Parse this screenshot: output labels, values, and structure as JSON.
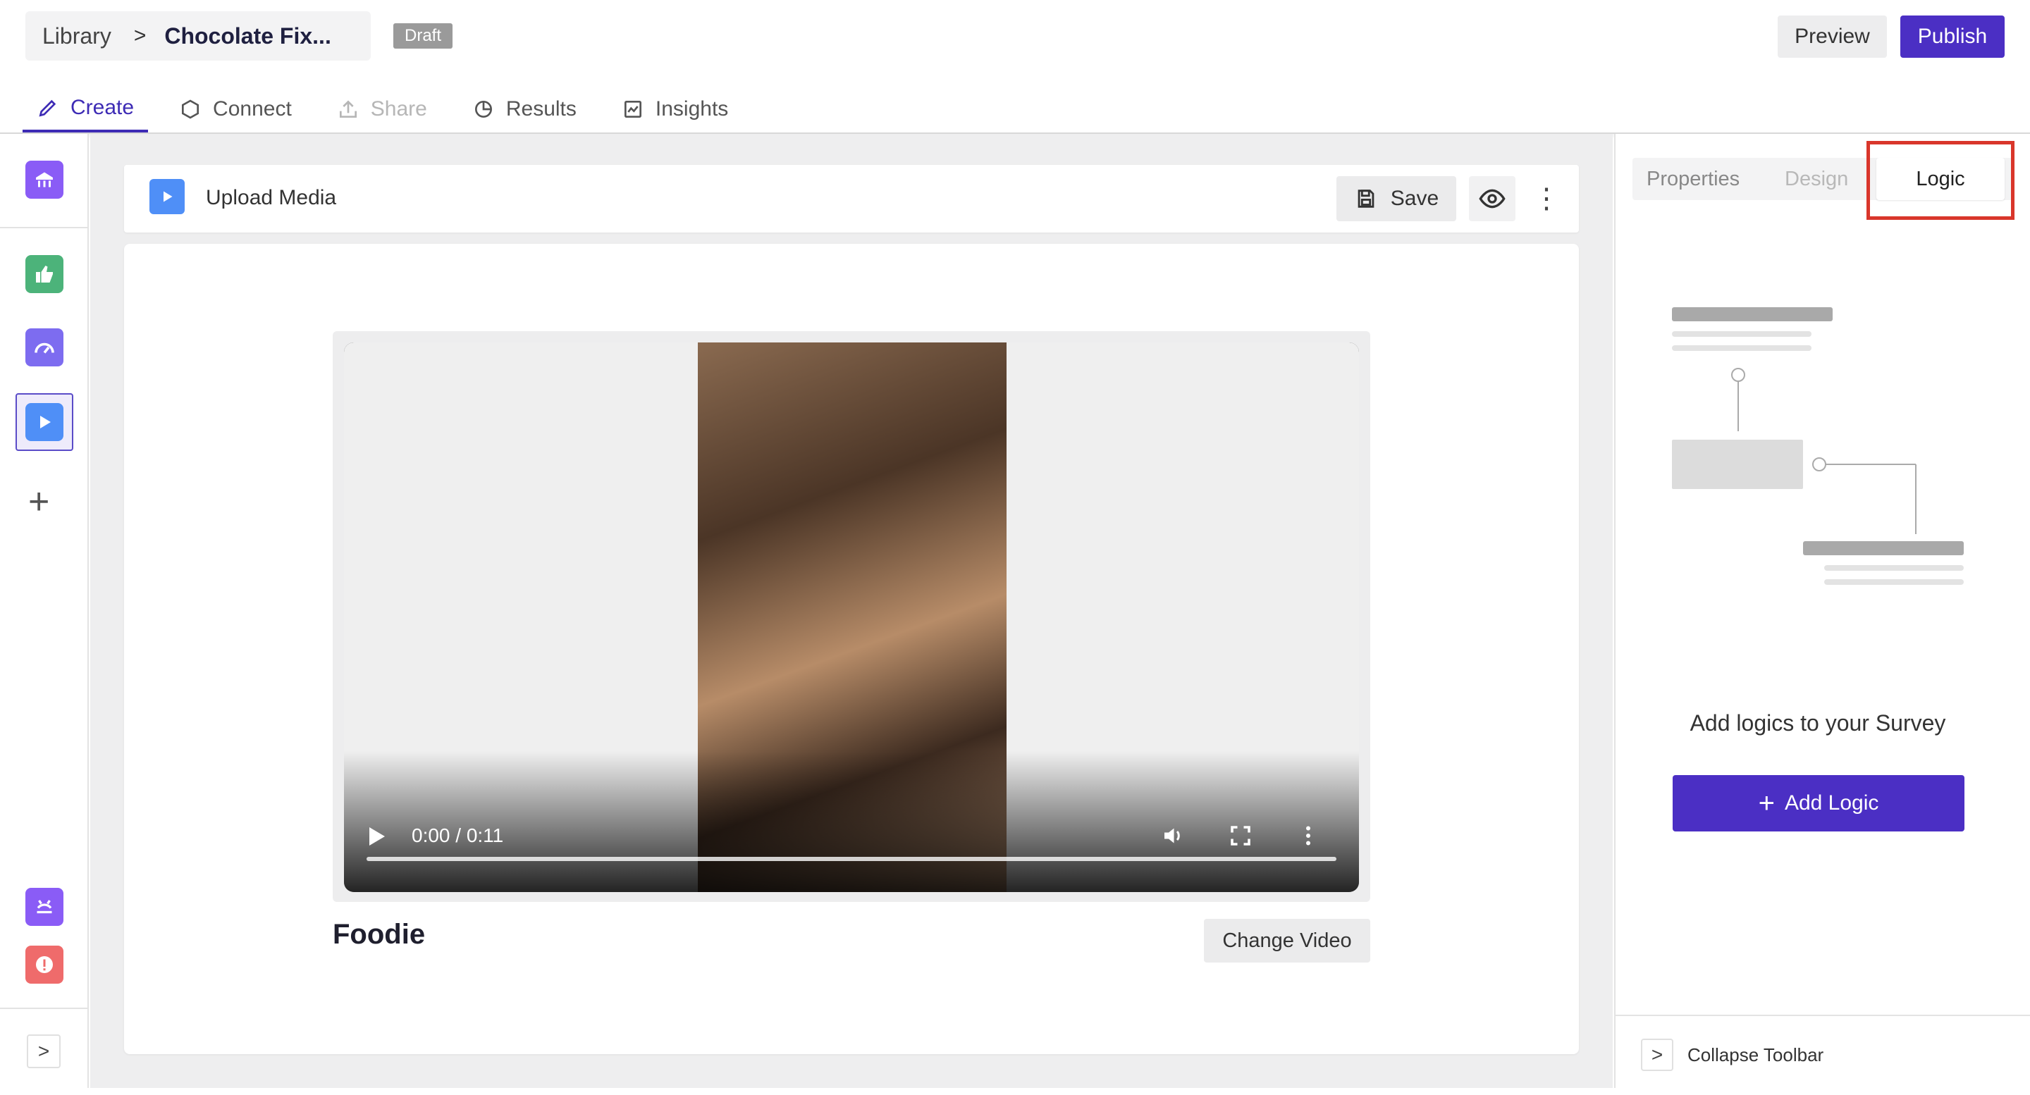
{
  "header": {
    "breadcrumb_root": "Library",
    "breadcrumb_separator": ">",
    "breadcrumb_current": "Chocolate Fix...",
    "status_badge": "Draft",
    "preview_label": "Preview",
    "publish_label": "Publish",
    "accent_color": "#4b2fc4"
  },
  "nav_tabs": [
    {
      "label": "Create",
      "icon": "pencil-icon",
      "active": true
    },
    {
      "label": "Connect",
      "icon": "hexagon-icon"
    },
    {
      "label": "Share",
      "icon": "upload-icon",
      "disabled": true
    },
    {
      "label": "Results",
      "icon": "pie-chart-icon"
    },
    {
      "label": "Insights",
      "icon": "line-chart-icon"
    }
  ],
  "left_rail": {
    "items": [
      "welcome-screen-icon",
      "thumbs-up-icon",
      "gauge-icon",
      "video-icon"
    ],
    "selected": "video-icon",
    "add_label": "+",
    "bottom_items": [
      "thank-you-icon",
      "alert-icon"
    ],
    "expand_label": ">"
  },
  "question": {
    "type_label": "Upload Media",
    "save_label": "Save",
    "more_label": "⋮",
    "title": "Foodie",
    "change_video_label": "Change Video"
  },
  "video": {
    "time": "0:00 / 0:11",
    "progress": 0
  },
  "panel": {
    "tabs": {
      "properties": "Properties",
      "design": "Design",
      "logic": "Logic"
    },
    "active_tab": "Logic",
    "highlight_color": "#d9362b",
    "message": "Add logics to your Survey",
    "add_logic_label": "Add Logic",
    "add_logic_plus": "+",
    "collapse_label": "Collapse Toolbar",
    "collapse_arrow": ">"
  }
}
